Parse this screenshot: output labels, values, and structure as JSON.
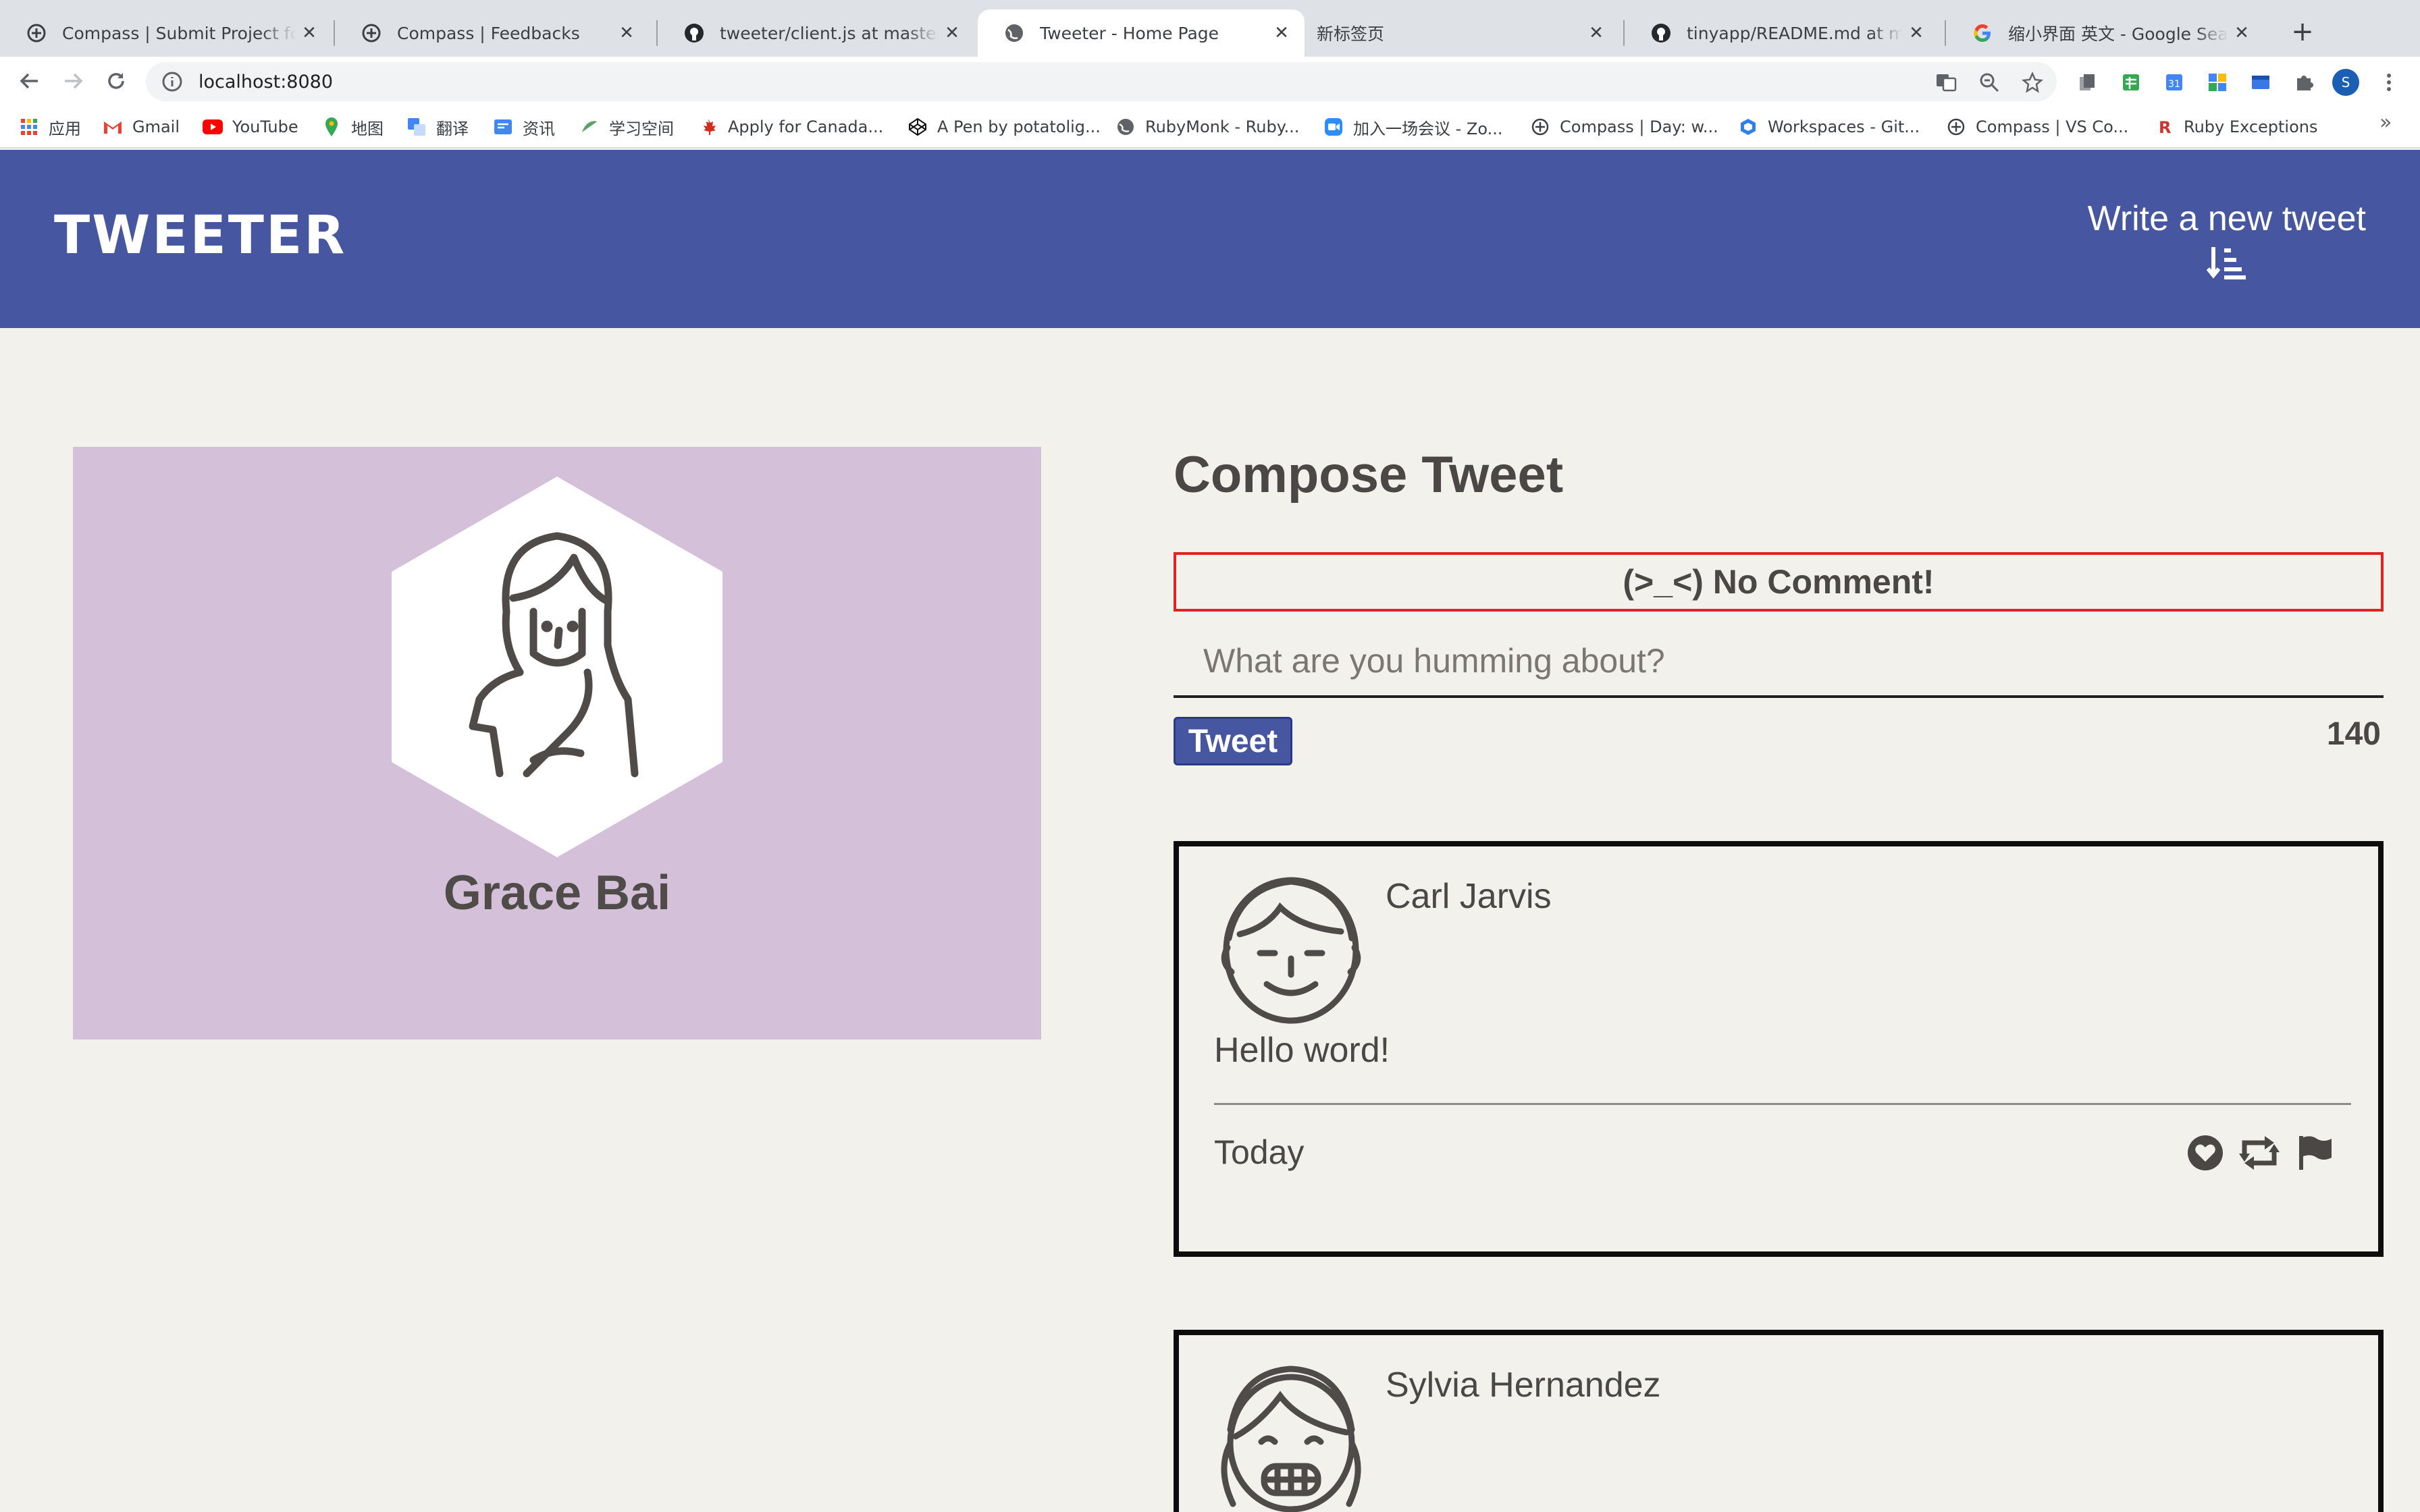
{
  "browser": {
    "tabs": [
      {
        "title": "Compass | Submit Project for Evaluation",
        "icon": "compass-icon",
        "active": false
      },
      {
        "title": "Compass | Feedbacks",
        "icon": "compass-icon",
        "active": false
      },
      {
        "title": "tweeter/client.js at master · potatoligi",
        "icon": "github-icon",
        "active": false
      },
      {
        "title": "Tweeter - Home Page",
        "icon": "globe-icon",
        "active": true
      },
      {
        "title": "新标签页",
        "icon": "",
        "active": false
      },
      {
        "title": "tinyapp/README.md at master",
        "icon": "github-icon",
        "active": false
      },
      {
        "title": "缩小界面 英文 - Google Search",
        "icon": "google-icon",
        "active": false
      }
    ],
    "url": "localhost:8080",
    "bookmarks": [
      {
        "label": "应用",
        "icon": "apps-grid-icon"
      },
      {
        "label": "Gmail",
        "icon": "gmail-icon"
      },
      {
        "label": "YouTube",
        "icon": "youtube-icon"
      },
      {
        "label": "地图",
        "icon": "maps-icon"
      },
      {
        "label": "翻译",
        "icon": "translate-icon"
      },
      {
        "label": "资讯",
        "icon": "news-icon"
      },
      {
        "label": "学习空间",
        "icon": "learning-icon"
      },
      {
        "label": "Apply for Canada...",
        "icon": "maple-leaf-icon"
      },
      {
        "label": "A Pen by potatolig...",
        "icon": "codepen-icon"
      },
      {
        "label": "RubyMonk - Ruby...",
        "icon": "globe-icon"
      },
      {
        "label": "加入一场会议 - Zo...",
        "icon": "zoom-icon"
      },
      {
        "label": "Compass | Day: w...",
        "icon": "compass-icon"
      },
      {
        "label": "Workspaces - Git...",
        "icon": "workspaces-icon"
      },
      {
        "label": "Compass | VS Co...",
        "icon": "compass-icon"
      },
      {
        "label": "Ruby Exceptions",
        "icon": "ruby-icon"
      }
    ],
    "profile_initial": "S"
  },
  "site": {
    "logo": "TWEETER",
    "write_new_label": "Write a new tweet",
    "brand_color": "#4656a0"
  },
  "profile": {
    "name": "Grace Bai",
    "card_color": "#d4c0d8"
  },
  "compose": {
    "title": "Compose Tweet",
    "error_message": "(>_<) No Comment!",
    "placeholder": "What are you humming about?",
    "tweet_button": "Tweet",
    "counter": "140",
    "error_color": "#e3221f"
  },
  "tweets": [
    {
      "name": "Carl Jarvis",
      "body": "Hello word!",
      "date": "Today",
      "avatar": "boy-avatar-icon"
    },
    {
      "name": "Sylvia Hernandez",
      "body": "",
      "date": "",
      "avatar": "girl-avatar-icon"
    }
  ]
}
